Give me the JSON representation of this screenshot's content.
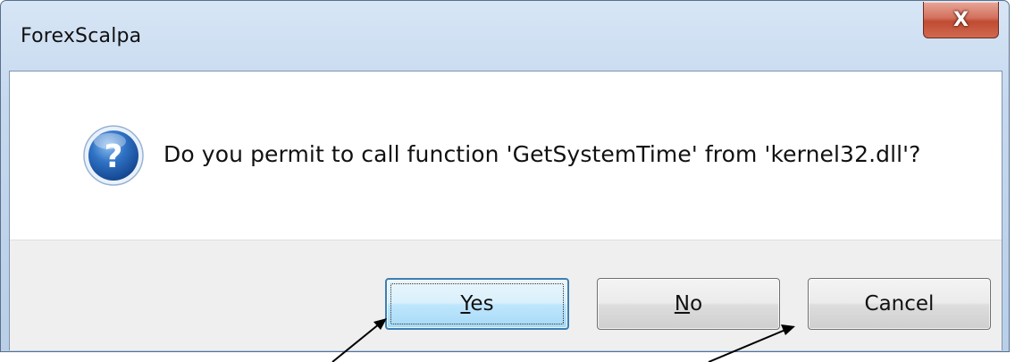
{
  "window": {
    "title": "ForexScalpa",
    "close_glyph": "X"
  },
  "dialog": {
    "icon": "question-icon",
    "message": "Do you permit to call function 'GetSystemTime' from 'kernel32.dll'?"
  },
  "buttons": {
    "yes": {
      "mnemonic": "Y",
      "rest": "es"
    },
    "no": {
      "mnemonic": "N",
      "rest": "o"
    },
    "cancel": {
      "label": "Cancel"
    }
  },
  "colors": {
    "title_gradient_top": "#d7e6f6",
    "close_red": "#c04b33",
    "default_button_border": "#3c7fb1",
    "icon_blue": "#1f5fb0"
  }
}
